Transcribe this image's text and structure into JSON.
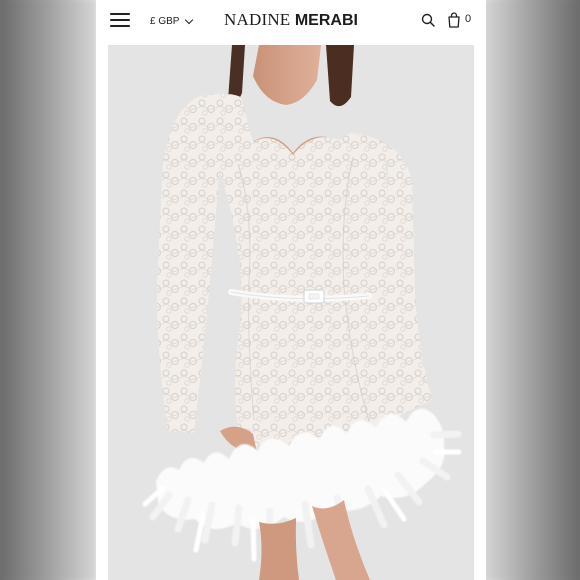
{
  "header": {
    "menu_icon": "hamburger-menu-icon",
    "currency": "£ GBP",
    "brand_light": "NADINE ",
    "brand_bold": "MERABI",
    "search_icon": "search-icon",
    "bag_icon": "shopping-bag-icon",
    "bag_count": "0"
  },
  "product_image": {
    "description_icon": "product-photo",
    "colors": {
      "background": "#e4e4e4",
      "dress": "#f3eeea",
      "lace_shadow": "#d6cfca",
      "skin": "#d7a58b",
      "hair": "#4a2f24",
      "feather": "#fbfbfb"
    }
  }
}
